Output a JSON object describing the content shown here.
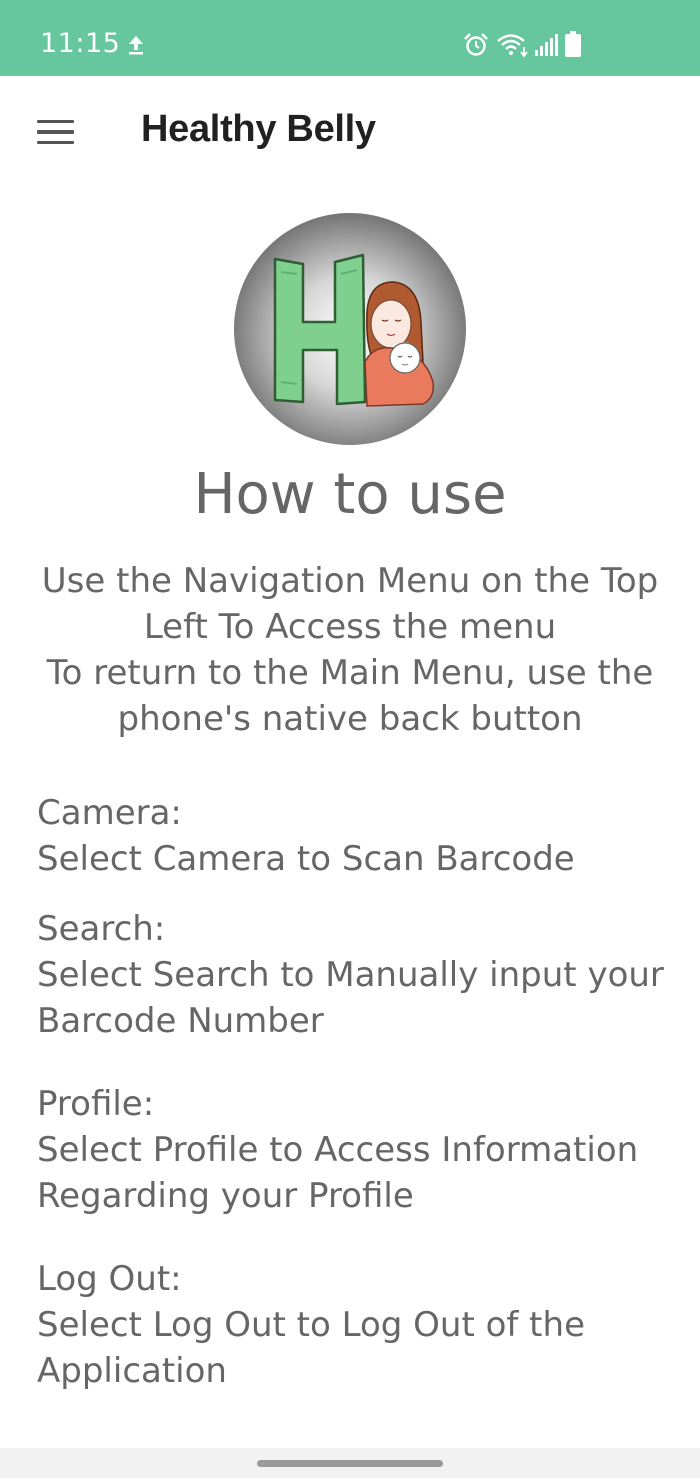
{
  "status_bar": {
    "time": "11:15",
    "color": "#66c69e",
    "icons": [
      "upload-icon",
      "alarm-icon",
      "wifi-icon",
      "signal-icon",
      "battery-icon"
    ]
  },
  "app_bar": {
    "title": "Healthy Belly",
    "menu_icon": "hamburger-menu-icon"
  },
  "content": {
    "heading": "How to use",
    "intro": [
      "Use the Navigation Menu on the Top",
      "Left To Access the menu",
      "To return to the Main Menu, use the",
      "phone's native back button"
    ],
    "sections": [
      {
        "heading": "Camera:",
        "lines": [
          "Select Camera to Scan Barcode"
        ]
      },
      {
        "heading": "Search:",
        "lines": [
          "Select Search to Manually input your",
          "Barcode Number"
        ]
      },
      {
        "heading": "Profile:",
        "lines": [
          "Select Profile to Access Information",
          "Regarding your Profile"
        ]
      },
      {
        "heading": "Log Out:",
        "lines": [
          "Select Log Out to Log Out of the",
          "Application"
        ]
      }
    ]
  }
}
